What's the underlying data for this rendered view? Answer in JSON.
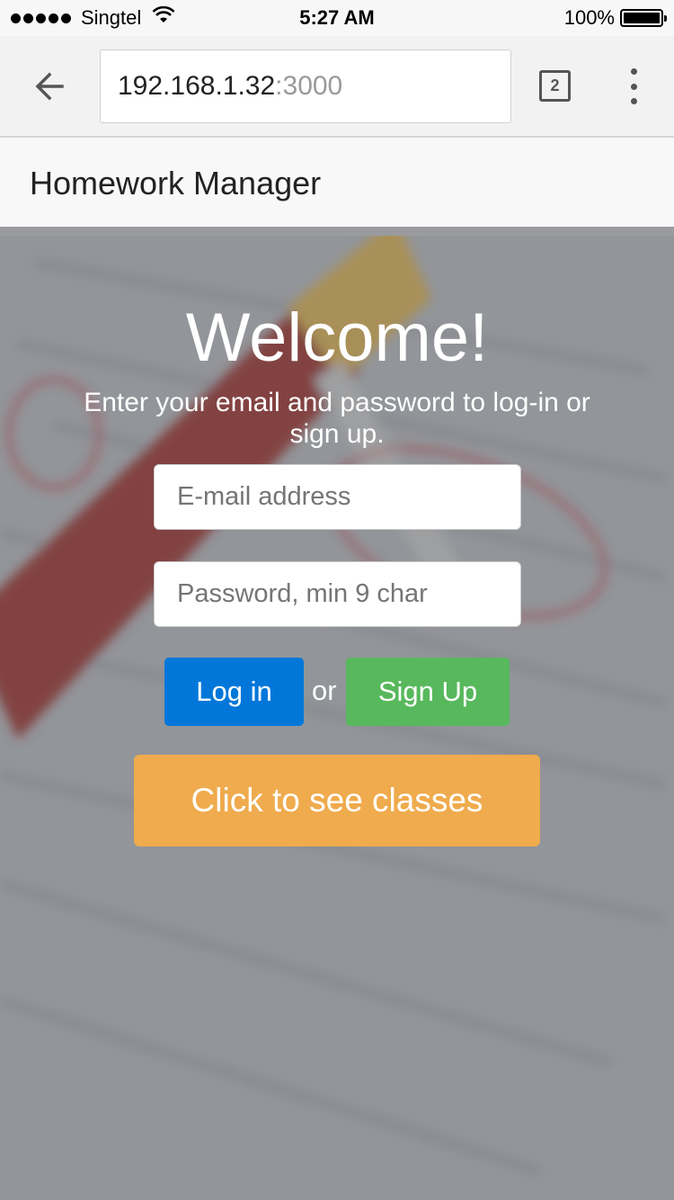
{
  "status_bar": {
    "carrier": "Singtel",
    "time": "5:27 AM",
    "battery": "100%"
  },
  "browser": {
    "url_host": "192.168.1.32",
    "url_port": ":3000",
    "tab_count": "2"
  },
  "app": {
    "brand": "Homework Manager"
  },
  "login": {
    "title": "Welcome!",
    "subtitle": "Enter your email and password to log-in or sign up.",
    "email_placeholder": "E-mail address",
    "password_placeholder": "Password, min 9 char",
    "login_label": "Log in",
    "or_label": "or",
    "signup_label": "Sign Up",
    "classes_label": "Click to see classes"
  },
  "colors": {
    "login_button": "#0277d9",
    "signup_button": "#58b85c",
    "classes_button": "#efab4d"
  }
}
